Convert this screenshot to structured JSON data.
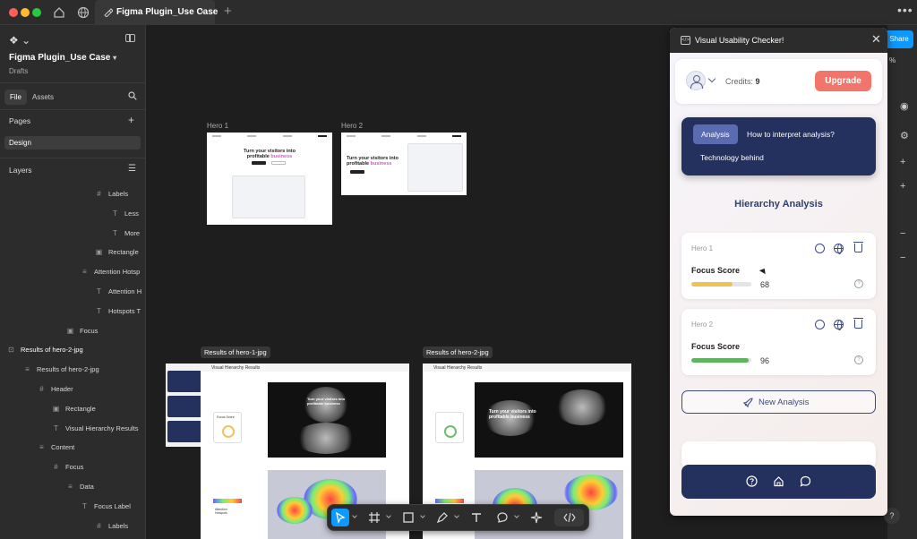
{
  "window": {
    "tab_title": "Figma Plugin_Use Case",
    "share_label": "Share",
    "zoom_fragment": "%",
    "help_label": "?"
  },
  "sidebar": {
    "project_title": "Figma Plugin_Use Case",
    "project_location": "Drafts",
    "tabs": [
      {
        "label": "File"
      },
      {
        "label": "Assets"
      }
    ],
    "pages_label": "Pages",
    "current_page": "Design",
    "layers_label": "Layers",
    "layers": [
      {
        "label": "Labels",
        "icon": "frame-icon"
      },
      {
        "label": "Less",
        "icon": "text-icon"
      },
      {
        "label": "More",
        "icon": "text-icon"
      },
      {
        "label": "Rectangle",
        "icon": "image-icon"
      },
      {
        "label": "Attention Hotsp",
        "icon": "auto-layout-icon"
      },
      {
        "label": "Attention H",
        "icon": "text-icon"
      },
      {
        "label": "Hotspots T",
        "icon": "text-icon"
      },
      {
        "label": "Focus",
        "icon": "image-icon"
      },
      {
        "label": "Results of hero-2-jpg",
        "icon": "section-icon"
      },
      {
        "label": "Results of hero-2-jpg",
        "icon": "auto-layout-icon"
      },
      {
        "label": "Header",
        "icon": "frame-icon"
      },
      {
        "label": "Rectangle",
        "icon": "image-icon"
      },
      {
        "label": "Visual Hierarchy Results",
        "icon": "text-icon"
      },
      {
        "label": "Content",
        "icon": "auto-layout-icon"
      },
      {
        "label": "Focus",
        "icon": "frame-icon"
      },
      {
        "label": "Data",
        "icon": "auto-layout-icon"
      },
      {
        "label": "Focus Label",
        "icon": "text-icon"
      },
      {
        "label": "Labels",
        "icon": "frame-icon"
      }
    ]
  },
  "canvas": {
    "frames": [
      {
        "label": "Hero 1",
        "headline_1": "Turn your visitors into",
        "headline_2": "profitable",
        "headline_hl": "business"
      },
      {
        "label": "Hero 2",
        "headline_1": "Turn your visitors into",
        "headline_2": "profitable",
        "headline_hl": "business"
      }
    ],
    "results": [
      {
        "label": "Results of hero-1-jpg",
        "header": "Visual Hierarchy Results",
        "score_label": "Focus Score",
        "heat_text_1": "Turn your visitors into",
        "heat_text_2": "profitable business",
        "side_label_1": "Attention",
        "side_label_2": "Hotspots"
      },
      {
        "label": "Results of hero-2-jpg",
        "header": "Visual Hierarchy Results",
        "heat_text_1": "Turn your visitors into",
        "heat_text_2": "profitable business"
      }
    ]
  },
  "plugin": {
    "title": "Visual Usability Checker!",
    "credits_label": "Credits:",
    "credits_value": "9",
    "upgrade_label": "Upgrade",
    "nav_tabs": [
      {
        "label": "Analysis",
        "active": true
      },
      {
        "label": "How to interpret analysis?"
      },
      {
        "label": "Technology behind"
      }
    ],
    "section_title": "Hierarchy Analysis",
    "results": [
      {
        "name": "Hero 1",
        "metric": "Focus Score",
        "score": 68,
        "color": "#f0c24e"
      },
      {
        "name": "Hero 2",
        "metric": "Focus Score",
        "score": 96,
        "color": "#5fb45f"
      }
    ],
    "new_analysis_label": "New Analysis"
  },
  "colors": {
    "accent": "#0d99ff",
    "plugin_navy": "#24305e",
    "upgrade": "#f1756a"
  }
}
